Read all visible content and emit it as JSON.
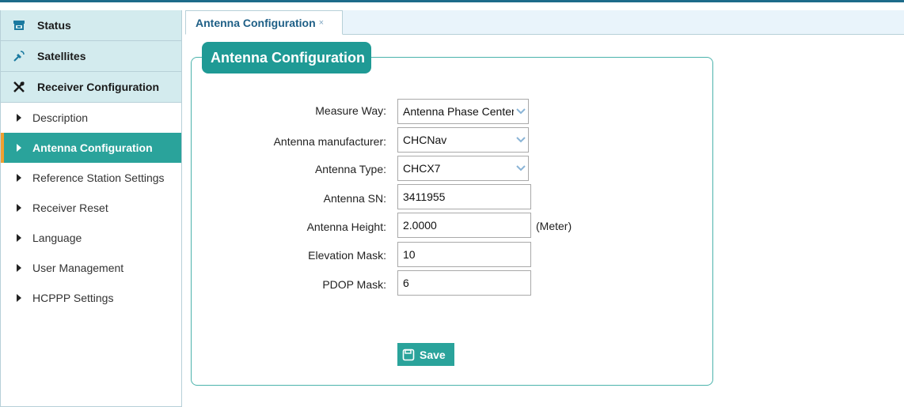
{
  "sidebar": {
    "top_items": [
      {
        "label": "Status",
        "icon": "status-icon"
      },
      {
        "label": "Satellites",
        "icon": "satellite-icon"
      },
      {
        "label": "Receiver Configuration",
        "icon": "tools-icon"
      }
    ],
    "sub_items": [
      {
        "label": "Description",
        "active": false
      },
      {
        "label": "Antenna Configuration",
        "active": true
      },
      {
        "label": "Reference Station Settings",
        "active": false
      },
      {
        "label": "Receiver Reset",
        "active": false
      },
      {
        "label": "Language",
        "active": false
      },
      {
        "label": "User Management",
        "active": false
      },
      {
        "label": "HCPPP Settings",
        "active": false
      }
    ]
  },
  "tabs": [
    {
      "label": "Antenna Configuration",
      "close": "×"
    }
  ],
  "panel": {
    "title": "Antenna Configuration",
    "fields": {
      "measure_way": {
        "label": "Measure Way:",
        "value": "Antenna Phase Center"
      },
      "manufacturer": {
        "label": "Antenna manufacturer:",
        "value": "CHCNav"
      },
      "type": {
        "label": "Antenna Type:",
        "value": "CHCX7"
      },
      "sn": {
        "label": "Antenna SN:",
        "value": "3411955"
      },
      "height": {
        "label": "Antenna Height:",
        "value": "2.0000",
        "unit": "(Meter)"
      },
      "elevation": {
        "label": "Elevation Mask:",
        "value": "10"
      },
      "pdop": {
        "label": "PDOP Mask:",
        "value": "6"
      }
    },
    "save_label": "Save"
  },
  "colors": {
    "accent": "#2aa39b",
    "active_marker": "#f0a030",
    "header_bg": "#d3ebee"
  }
}
